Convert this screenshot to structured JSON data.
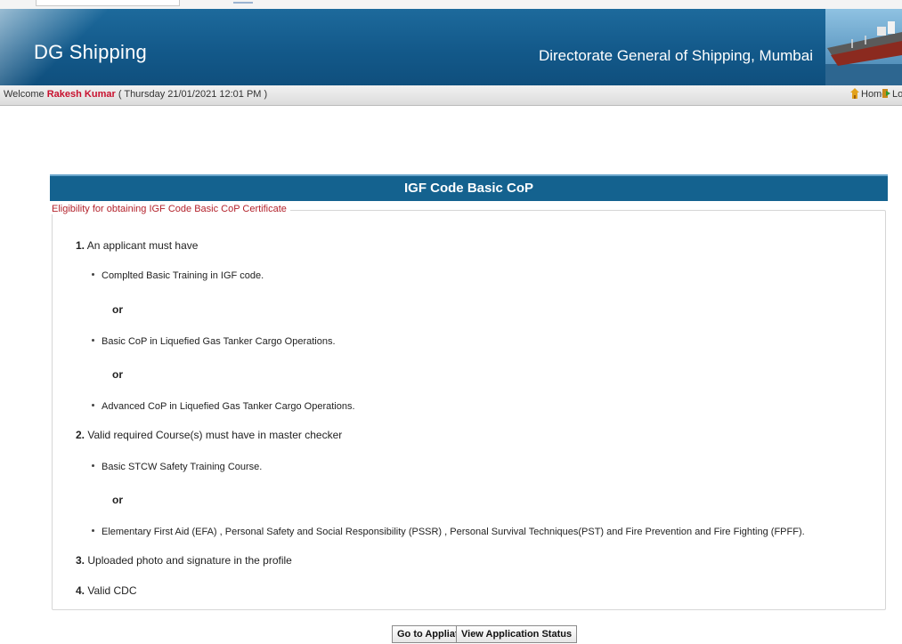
{
  "header": {
    "brand": "DG Shipping",
    "organization": "Directorate General of Shipping, Mumbai"
  },
  "welcome_bar": {
    "welcome_label": "Welcome",
    "user_name": "Rakesh Kumar",
    "datetime": "( Thursday 21/01/2021 12:01 PM )",
    "home_label": "Home",
    "logout_label": "Logout"
  },
  "panel": {
    "title": "IGF Code Basic CoP",
    "legend": "Eligibility for obtaining IGF Code Basic CoP Certificate",
    "items": [
      {
        "num": "1.",
        "text": "An applicant must have",
        "bullets": [
          "Complted Basic Training in IGF code.",
          "Basic CoP in Liquefied Gas Tanker Cargo Operations.",
          "Advanced CoP in Liquefied Gas Tanker Cargo Operations."
        ]
      },
      {
        "num": "2.",
        "text": "Valid required Course(s) must have in master checker",
        "bullets": [
          "Basic STCW Safety Training Course.",
          "Elementary First Aid (EFA) , Personal Safety and Social Responsibility (PSSR) , Personal Survival Techniques(PST)  and  Fire Prevention and Fire Fighting (FPFF)."
        ]
      },
      {
        "num": "3.",
        "text": "Uploaded photo and signature in the profile"
      },
      {
        "num": "4.",
        "text": "Valid CDC"
      }
    ],
    "or_label": "or"
  },
  "buttons": {
    "go_to_application": "Go to Appliation",
    "view_status": "View Application Status"
  },
  "colors": {
    "header_blue": "#13598a",
    "panel_blue": "#14628f",
    "user_red": "#c8102e",
    "legend_red": "#b3222b"
  }
}
